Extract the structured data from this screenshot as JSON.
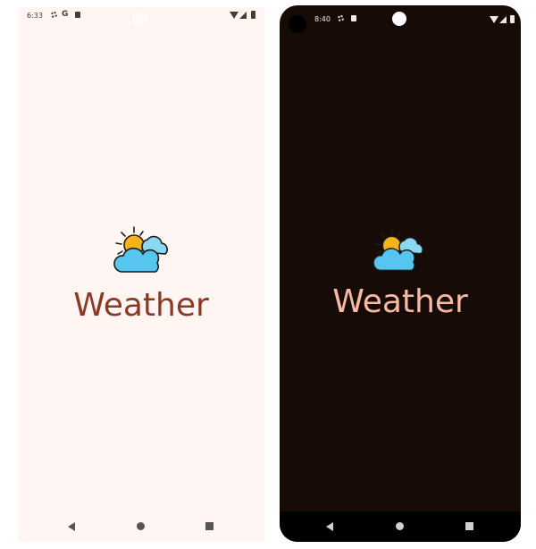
{
  "light_screen": {
    "status_time": "6:33",
    "status_g_letter": "G",
    "title": "Weather",
    "icon": "weather-sun-cloud-icon"
  },
  "dark_screen": {
    "status_time": "8:40",
    "title": "Weather",
    "icon": "weather-sun-cloud-icon"
  },
  "colors": {
    "light_bg": "#fff6f4",
    "light_title": "#8a3a22",
    "dark_bg": "#170b08",
    "dark_title": "#f8b8a1",
    "sun": "#f6b21b",
    "cloud": "#56c5ef"
  }
}
